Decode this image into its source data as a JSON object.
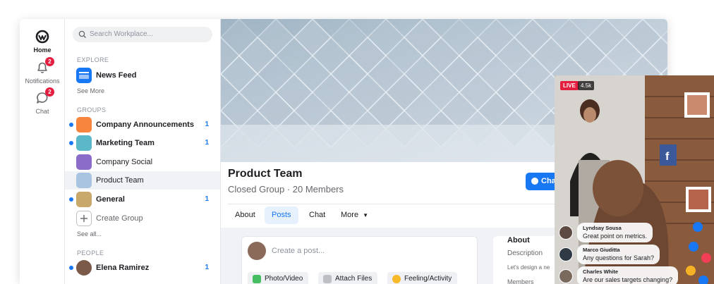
{
  "rail": {
    "home": "Home",
    "notifications": "Notifications",
    "notifications_count": "2",
    "chat": "Chat",
    "chat_count": "2"
  },
  "sidebar": {
    "search_placeholder": "Search Workplace...",
    "explore_label": "EXPLORE",
    "news_feed": "News Feed",
    "see_more": "See More",
    "groups_label": "GROUPS",
    "groups": [
      {
        "name": "Company Announcements",
        "count": "1",
        "unread": true,
        "color": "#f7853e"
      },
      {
        "name": "Marketing Team",
        "count": "1",
        "unread": true,
        "color": "#5ab8c9"
      },
      {
        "name": "Company Social",
        "count": "",
        "unread": false,
        "color": "#8b6cc9"
      },
      {
        "name": "Product Team",
        "count": "",
        "unread": false,
        "color": "#a9c4e0"
      },
      {
        "name": "General",
        "count": "1",
        "unread": true,
        "color": "#c9a86b"
      }
    ],
    "create_group": "Create Group",
    "see_all": "See all...",
    "people_label": "PEOPLE",
    "people": [
      {
        "name": "Elena Ramirez",
        "count": "1",
        "unread": true
      }
    ]
  },
  "group": {
    "title": "Product Team",
    "subtitle": "Closed Group · 20 Members",
    "chat_button": "Cha",
    "tabs": [
      "About",
      "Posts",
      "Chat",
      "More"
    ],
    "active_tab": "Posts"
  },
  "composer": {
    "placeholder": "Create a post...",
    "actions": [
      "Photo/Video",
      "Attach Files",
      "Feeling/Activity"
    ]
  },
  "about": {
    "heading": "About",
    "description_label": "Description",
    "description_text": "Let's design a ne",
    "members_label": "Members"
  },
  "live": {
    "badge": "LIVE",
    "viewers": "4.5k",
    "comments": [
      {
        "name": "Lyndsay Sousa",
        "text": "Great point on metrics."
      },
      {
        "name": "Marco Giuditta",
        "text": "Any questions for Sarah?"
      },
      {
        "name": "Charles White",
        "text": "Are our sales targets changing?"
      }
    ]
  },
  "colors": {
    "accent": "#1877f2",
    "badge": "#e41e3f",
    "live": "#e41e3f"
  }
}
